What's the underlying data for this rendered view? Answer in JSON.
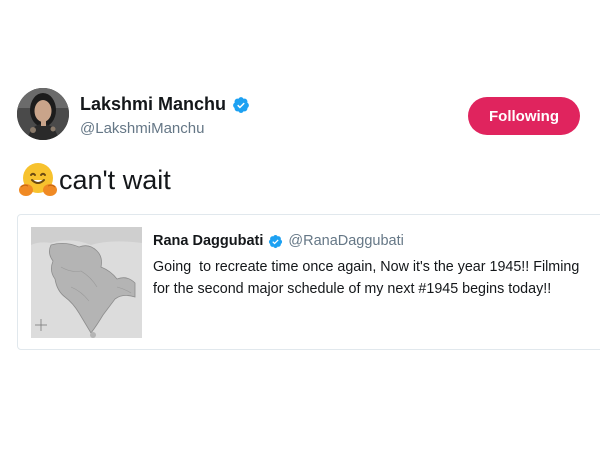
{
  "tweet": {
    "author": {
      "name": "Lakshmi Manchu",
      "handle": "@LakshmiManchu",
      "verified": true,
      "verified_color": "#1da1f2"
    },
    "follow_button": {
      "label": "Following",
      "color": "#e0245e"
    },
    "text": "can't wait",
    "emoji": "hugging-face"
  },
  "quoted_tweet": {
    "author": {
      "name": "Rana Daggubati",
      "handle": "@RanaDaggubati",
      "verified": true
    },
    "text_line1": "Going  to recreate time once again, Now it's the year 1945!! Filming",
    "text_line2": "for the second major schedule of my next #1945 begins today!!",
    "image": "map-of-british-india"
  }
}
